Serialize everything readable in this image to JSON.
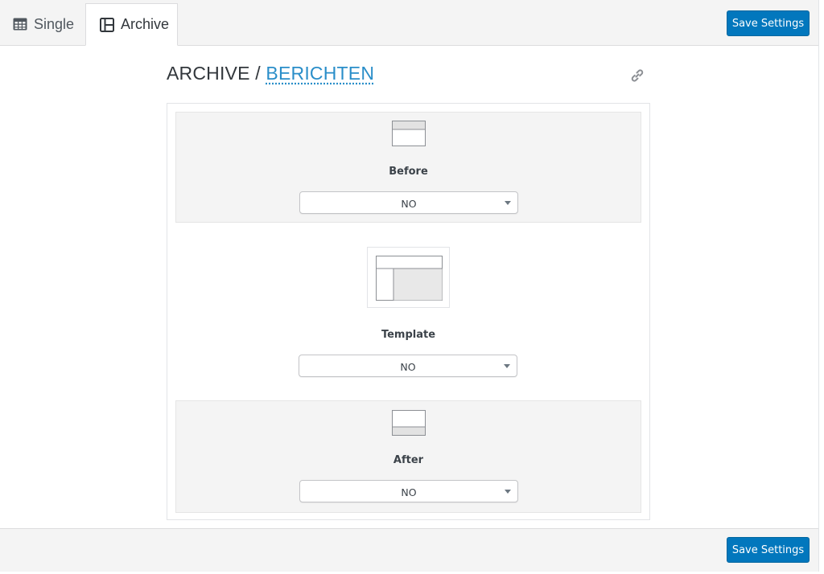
{
  "tabs": [
    {
      "label": "Single",
      "icon": "table-icon",
      "active": false
    },
    {
      "label": "Archive",
      "icon": "layout-sidebar-icon",
      "active": true
    }
  ],
  "buttons": {
    "save_top": "Save Settings",
    "save_bottom": "Save Settings"
  },
  "title": {
    "prefix": "ARCHIVE / ",
    "link": "BERICHTEN"
  },
  "sections": [
    {
      "label": "Before",
      "icon": "layout-header-icon",
      "select_value": "NO"
    },
    {
      "label": "Template",
      "icon": "layout-content-sidebar-icon",
      "select_value": "NO"
    },
    {
      "label": "After",
      "icon": "layout-footer-icon",
      "select_value": "NO"
    }
  ],
  "colors": {
    "accent": "#0277bd",
    "link": "#2a8ec9",
    "panel_gray": "#f4f4f4"
  }
}
